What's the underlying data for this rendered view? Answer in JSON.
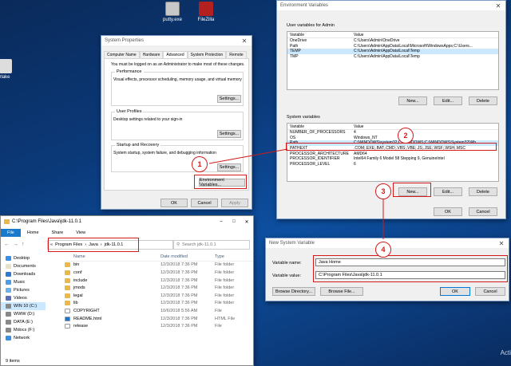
{
  "desktop": {
    "icons": [
      {
        "label": "putty.exe"
      },
      {
        "label": "FileZilla"
      },
      {
        "label": "rlake"
      }
    ],
    "right_edge_text": "Acti"
  },
  "system_properties": {
    "title": "System Properties",
    "tabs": [
      "Computer Name",
      "Hardware",
      "Advanced",
      "System Protection",
      "Remote"
    ],
    "admin_note": "You must be logged on as an Administrator to make most of these changes.",
    "performance": {
      "heading": "Performance",
      "desc": "Visual effects, processor scheduling, memory usage, and virtual memory",
      "button": "Settings..."
    },
    "user_profiles": {
      "heading": "User Profiles",
      "desc": "Desktop settings related to your sign-in",
      "button": "Settings..."
    },
    "startup": {
      "heading": "Startup and Recovery",
      "desc": "System startup, system failure, and debugging information",
      "button": "Settings..."
    },
    "env_button": "Environment Variables...",
    "ok": "OK",
    "cancel": "Cancel",
    "apply": "Apply"
  },
  "env_vars": {
    "title": "Environment Variables",
    "user_heading": "User variables for Admin",
    "col_variable": "Variable",
    "col_value": "Value",
    "user_rows": [
      {
        "name": "OneDrive",
        "value": "C:\\Users\\Admin\\OneDrive"
      },
      {
        "name": "Path",
        "value": "C:\\Users\\Admin\\AppData\\Local\\Microsoft\\WindowsApps;C:\\Users..."
      },
      {
        "name": "TEMP",
        "value": "C:\\Users\\Admin\\AppData\\Local\\Temp"
      },
      {
        "name": "TMP",
        "value": "C:\\Users\\Admin\\AppData\\Local\\Temp"
      }
    ],
    "system_heading": "System variables",
    "system_rows": [
      {
        "name": "NUMBER_OF_PROCESSORS",
        "value": "4"
      },
      {
        "name": "OS",
        "value": "Windows_NT"
      },
      {
        "name": "Path",
        "value": "C:\\WINDOWS\\system32;C:\\WINDOWS;C:\\WINDOWS\\System32\\Wb..."
      },
      {
        "name": "PATHEXT",
        "value": ".COM;.EXE;.BAT;.CMD;.VBS;.VBE;.JS;.JSE;.WSF;.WSH;.MSC"
      },
      {
        "name": "PROCESSOR_ARCHITECTURE",
        "value": "AMD64"
      },
      {
        "name": "PROCESSOR_IDENTIFIER",
        "value": "Intel64 Family 6 Model 58 Stepping 9, GenuineIntel"
      },
      {
        "name": "PROCESSOR_LEVEL",
        "value": "6"
      }
    ],
    "new": "New...",
    "edit": "Edit...",
    "delete": "Delete",
    "ok": "OK",
    "cancel": "Cancel"
  },
  "new_var": {
    "title": "New System Variable",
    "name_label": "Variable name:",
    "name_value": "Java Home",
    "value_label": "Variable value:",
    "value_value": "C:\\Program Files\\Java\\jdk-11.0.1",
    "browse_dir": "Browse Directory...",
    "browse_file": "Browse File...",
    "ok": "OK",
    "cancel": "Cancel"
  },
  "explorer": {
    "title": "C:\\Program Files\\Java\\jdk-11.0.1",
    "ribbon": [
      "File",
      "Home",
      "Share",
      "View"
    ],
    "breadcrumb": [
      "Program Files",
      "Java",
      "jdk-11.0.1"
    ],
    "breadcrumb_prefix": "«",
    "search_placeholder": "Search jdk-11.0.1",
    "nav": [
      "Desktop",
      "Documents",
      "Downloads",
      "Music",
      "Pictures",
      "Videos",
      "WIN 10 (C:)",
      "WWW (D:)",
      "DATA (E:)",
      "Mdocs (F:)",
      "Network"
    ],
    "col_name": "Name",
    "col_date": "Date modified",
    "col_type": "Type",
    "files": [
      {
        "name": "bin",
        "date": "12/3/2018 7:36 PM",
        "type": "File folder",
        "kind": "folder"
      },
      {
        "name": "conf",
        "date": "12/3/2018 7:36 PM",
        "type": "File folder",
        "kind": "folder"
      },
      {
        "name": "include",
        "date": "12/3/2018 7:36 PM",
        "type": "File folder",
        "kind": "folder"
      },
      {
        "name": "jmods",
        "date": "12/3/2018 7:36 PM",
        "type": "File folder",
        "kind": "folder"
      },
      {
        "name": "legal",
        "date": "12/3/2018 7:36 PM",
        "type": "File folder",
        "kind": "folder"
      },
      {
        "name": "lib",
        "date": "12/3/2018 7:36 PM",
        "type": "File folder",
        "kind": "folder"
      },
      {
        "name": "COPYRIGHT",
        "date": "10/6/2018 5:56 AM",
        "type": "File",
        "kind": "file"
      },
      {
        "name": "README.html",
        "date": "12/3/2018 7:36 PM",
        "type": "HTML File",
        "kind": "html"
      },
      {
        "name": "release",
        "date": "12/3/2018 7:36 PM",
        "type": "File",
        "kind": "file"
      }
    ],
    "status": "9 items"
  },
  "annotations": [
    "1",
    "2",
    "3",
    "4"
  ]
}
